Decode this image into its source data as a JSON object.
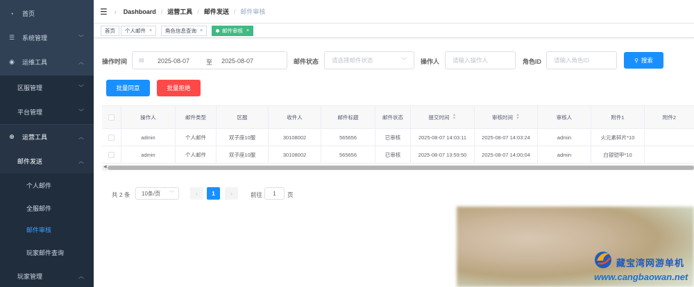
{
  "sidebar": {
    "items": [
      {
        "label": "首页",
        "icon": "dashboard-icon"
      },
      {
        "label": "系统管理",
        "icon": "system-icon"
      },
      {
        "label": "运维工具",
        "icon": "globe-icon"
      },
      {
        "label": "区服管理"
      },
      {
        "label": "平台管理"
      },
      {
        "label": "运营工具",
        "icon": "plus-circle-icon"
      },
      {
        "label": "邮件发送"
      },
      {
        "label": "个人邮件"
      },
      {
        "label": "全服邮件"
      },
      {
        "label": "邮件审核"
      },
      {
        "label": "玩家邮件查询"
      },
      {
        "label": "玩家管理"
      }
    ]
  },
  "navbar": {
    "breadcrumb": [
      "Dashboard",
      "运营工具",
      "邮件发送",
      "邮件审核"
    ]
  },
  "tags": [
    {
      "label": "首页"
    },
    {
      "label": "个人邮件"
    },
    {
      "label": "角色信息查询"
    },
    {
      "label": "邮件审核"
    }
  ],
  "search": {
    "time_label": "操作时间",
    "start_date": "2025-08-07",
    "range_sep": "至",
    "end_date": "2025-08-07",
    "status_label": "邮件状态",
    "status_placeholder": "请选择邮件状态",
    "operator_label": "操作人",
    "operator_placeholder": "请输入操作人",
    "role_label": "角色ID",
    "role_placeholder": "请输入角色ID",
    "search_button": "搜索"
  },
  "actions": {
    "approve_all": "批量同意",
    "reject_all": "批量拒绝"
  },
  "table": {
    "headers": [
      "操作人",
      "邮件类型",
      "区服",
      "收件人",
      "邮件标题",
      "邮件状态",
      "提交时间",
      "审核时间",
      "审核人",
      "附件1",
      "附件2"
    ],
    "rows": [
      [
        "admin",
        "个人邮件",
        "双子座10服",
        "30108002",
        "565656",
        "已审核",
        "2025-08-07 14:03:11",
        "2025-08-07 14:03:24",
        "admin",
        "火元素碎片*10",
        ""
      ],
      [
        "admin",
        "个人邮件",
        "双子座10服",
        "30108002",
        "565656",
        "已审核",
        "2025-08-07 13:59:50",
        "2025-08-07 14:00:04",
        "admin",
        "白银铠甲*10",
        ""
      ]
    ]
  },
  "pagination": {
    "total": "共 2 条",
    "page_size": "10条/页",
    "current_page": "1",
    "goto_label": "前往",
    "goto_value": "1",
    "page_unit": "页"
  },
  "watermark": {
    "site_name": "藏宝湾网游单机",
    "url": "www.cangbaowan.net"
  },
  "colors": {
    "sidebar_bg": "#304156",
    "primary": "#1890ff",
    "danger": "#ff4949",
    "active_tag": "#42b983"
  }
}
